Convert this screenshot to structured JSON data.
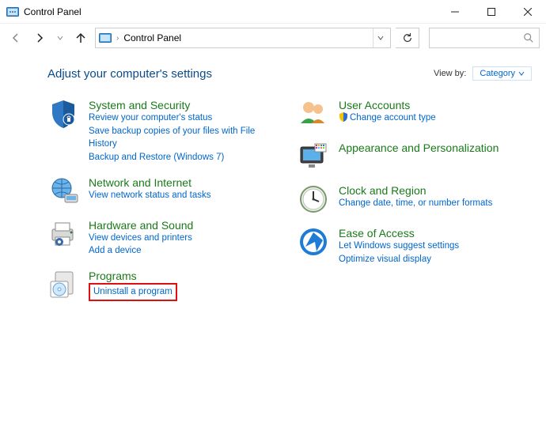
{
  "window": {
    "title": "Control Panel"
  },
  "address": {
    "crumb": "Control Panel"
  },
  "page": {
    "heading": "Adjust your computer's settings",
    "viewby_label": "View by:",
    "viewby_value": "Category"
  },
  "left_categories": [
    {
      "title": "System and Security",
      "links": [
        "Review your computer's status",
        "Save backup copies of your files with File History",
        "Backup and Restore (Windows 7)"
      ]
    },
    {
      "title": "Network and Internet",
      "links": [
        "View network status and tasks"
      ]
    },
    {
      "title": "Hardware and Sound",
      "links": [
        "View devices and printers",
        "Add a device"
      ]
    },
    {
      "title": "Programs",
      "links": [
        "Uninstall a program"
      ]
    }
  ],
  "right_categories": [
    {
      "title": "User Accounts",
      "links": [
        "Change account type"
      ],
      "shield_links": [
        0
      ]
    },
    {
      "title": "Appearance and Personalization",
      "links": []
    },
    {
      "title": "Clock and Region",
      "links": [
        "Change date, time, or number formats"
      ]
    },
    {
      "title": "Ease of Access",
      "links": [
        "Let Windows suggest settings",
        "Optimize visual display"
      ]
    }
  ]
}
